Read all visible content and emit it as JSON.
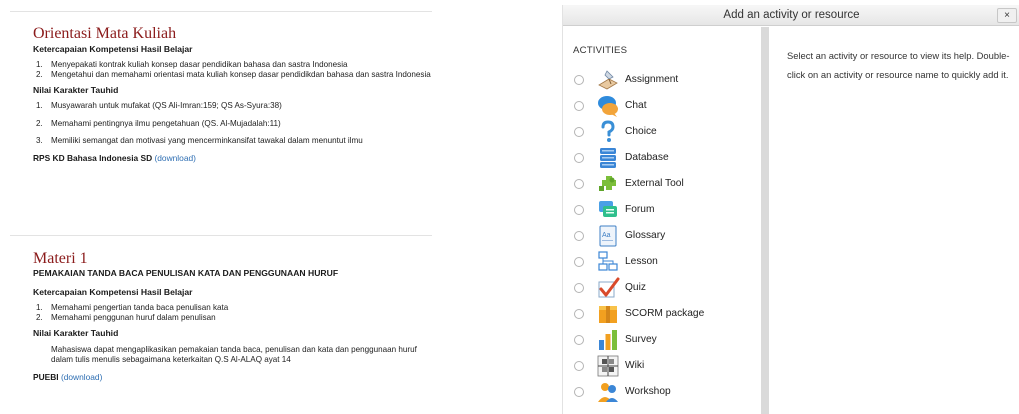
{
  "course": {
    "sections": [
      {
        "title": "Orientasi Mata Kuliah",
        "subtitle": "",
        "competency_heading": "Ketercapaian Kompetensi Hasil Belajar",
        "competencies": [
          {
            "n": "1.",
            "text": "Menyepakati kontrak kuliah konsep dasar pendidikan bahasa dan sastra Indonesia"
          },
          {
            "n": "2.",
            "text": "Mengetahui dan memahami orientasi mata kuliah konsep dasar pendidikdan bahasa dan sastra Indonesia"
          }
        ],
        "character_heading": "Nilai Karakter Tauhid",
        "character_items": [
          {
            "n": "1.",
            "text": "Musyawarah untuk mufakat (QS Ali-Imran:159; QS As-Syura:38)"
          },
          {
            "n": "2.",
            "text": "Memahami pentingnya ilmu pengetahuan (QS. Al-Mujadalah:11)"
          },
          {
            "n": "3.",
            "text": "Memiliki semangat dan motivasi yang mencerminkansifat tawakal dalam menuntut ilmu"
          }
        ],
        "resource_name": "RPS KD Bahasa Indonesia SD",
        "resource_link": "(download)"
      },
      {
        "title": "Materi 1",
        "subtitle": "PEMAKAIAN TANDA BACA PENULISAN KATA DAN PENGGUNAAN HURUF",
        "competency_heading": "Ketercapaian Kompetensi Hasil Belajar",
        "competencies": [
          {
            "n": "1.",
            "text": "Memahami pengertian tanda baca penulisan  kata"
          },
          {
            "n": "2.",
            "text": "Memahami penggunan huruf dalam penulisan"
          }
        ],
        "character_heading": "Nilai Karakter Tauhid",
        "character_text": "Mahasiswa dapat mengaplikasikan pemakaian tanda baca, penulisan dan kata dan penggunaan huruf dalam tulis menulis sebagaimana keterkaitan  Q.S Al-ALAQ ayat 14",
        "resource_name": "PUEBI",
        "resource_link": "(download)"
      }
    ]
  },
  "chooser": {
    "title": "Add an activity or resource",
    "close_label": "×",
    "activities_heading": "ACTIVITIES",
    "activities": [
      {
        "label": "Assignment",
        "icon": "assignment-icon"
      },
      {
        "label": "Chat",
        "icon": "chat-icon"
      },
      {
        "label": "Choice",
        "icon": "choice-icon"
      },
      {
        "label": "Database",
        "icon": "database-icon"
      },
      {
        "label": "External Tool",
        "icon": "external-tool-icon"
      },
      {
        "label": "Forum",
        "icon": "forum-icon"
      },
      {
        "label": "Glossary",
        "icon": "glossary-icon"
      },
      {
        "label": "Lesson",
        "icon": "lesson-icon"
      },
      {
        "label": "Quiz",
        "icon": "quiz-icon"
      },
      {
        "label": "SCORM package",
        "icon": "scorm-package-icon"
      },
      {
        "label": "Survey",
        "icon": "survey-icon"
      },
      {
        "label": "Wiki",
        "icon": "wiki-icon"
      },
      {
        "label": "Workshop",
        "icon": "workshop-icon"
      }
    ],
    "help_text": "Select an activity or resource to view its help. Double-click on an activity or resource name to quickly add it."
  }
}
